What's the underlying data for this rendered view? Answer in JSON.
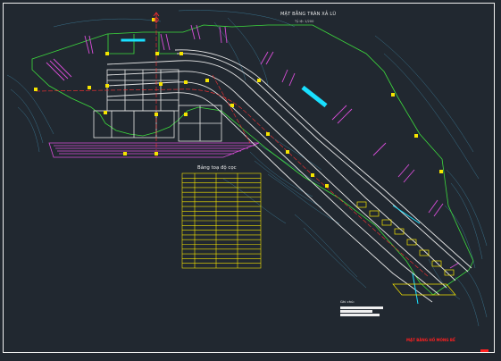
{
  "drawing": {
    "title": "MẶT BẰNG TRÀN XẢ LŨ",
    "subtitle": "Tỷ lệ: 1/200",
    "table_title": "Bảng toạ độ cọc",
    "notes_title": "Ghi chú:",
    "red_note": "MẶT BẰNG HỐ MÓNG BỂ",
    "colors": {
      "background": "#212830",
      "frame": "#f0f0f0",
      "terrain": "#3d7f9c",
      "boundary": "#3ddc3d",
      "hatch": "#d94ed9",
      "axis": "#ff3030",
      "markers": "#f5e400",
      "table": "#f5e400",
      "structure": "#e6e6e6",
      "accent": "#19e0ff"
    },
    "icons": [
      "north-arrow-icon"
    ]
  }
}
